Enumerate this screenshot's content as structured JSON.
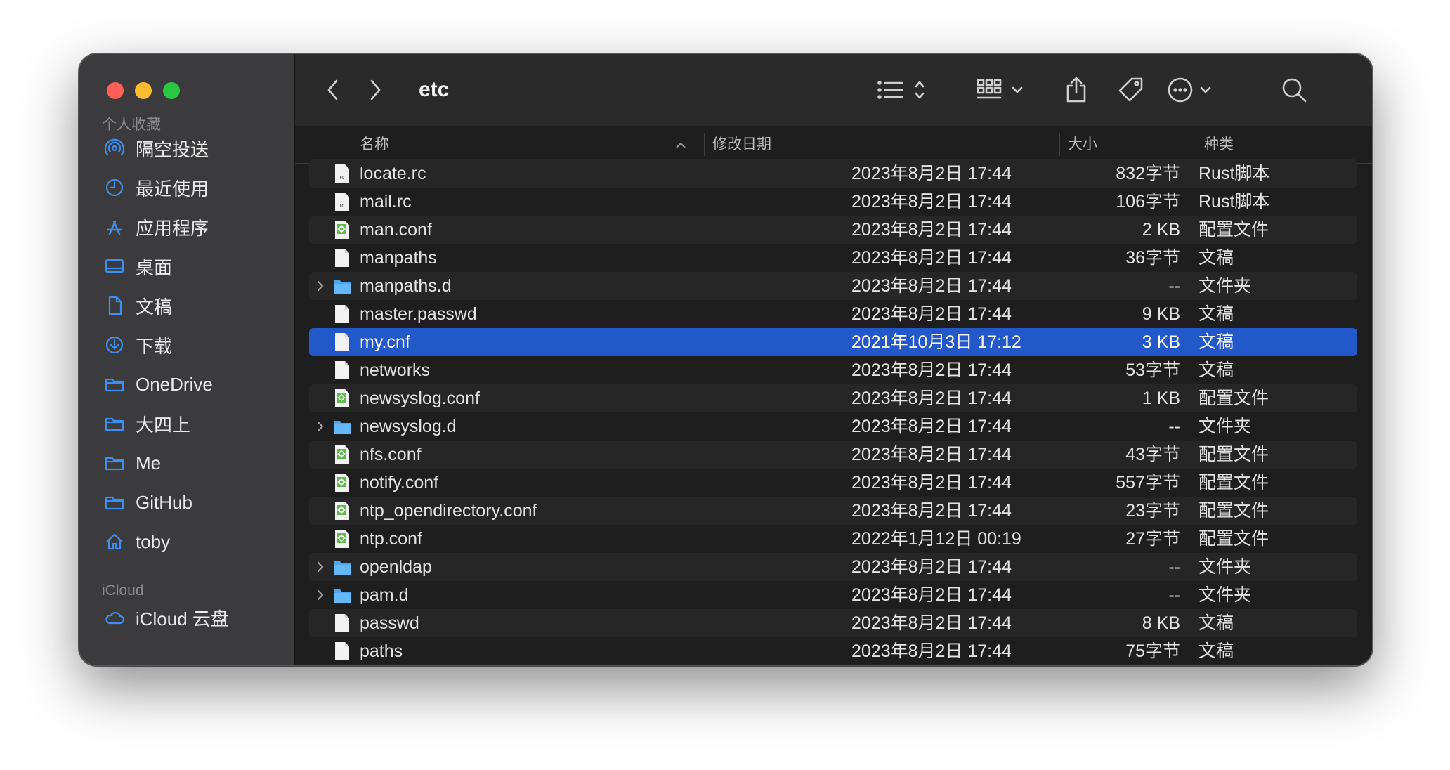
{
  "toolbar": {
    "title": "etc",
    "back_icon": "chevron-left-icon",
    "forward_icon": "chevron-right-icon",
    "view_icon": "list-view-icon",
    "group_icon": "grid-group-icon",
    "share_icon": "share-icon",
    "tag_icon": "tag-icon",
    "more_icon": "ellipsis-circle-icon",
    "search_icon": "search-icon"
  },
  "sidebar": {
    "favorites_title": "个人收藏",
    "items": [
      {
        "label": "隔空投送",
        "icon": "airdrop-icon"
      },
      {
        "label": "最近使用",
        "icon": "clock-icon"
      },
      {
        "label": "应用程序",
        "icon": "applications-icon"
      },
      {
        "label": "桌面",
        "icon": "desktop-icon"
      },
      {
        "label": "文稿",
        "icon": "document-icon"
      },
      {
        "label": "下载",
        "icon": "download-icon"
      },
      {
        "label": "OneDrive",
        "icon": "folder-icon"
      },
      {
        "label": "大四上",
        "icon": "folder-icon"
      },
      {
        "label": "Me",
        "icon": "folder-icon"
      },
      {
        "label": "GitHub",
        "icon": "folder-icon"
      },
      {
        "label": "toby",
        "icon": "home-icon"
      }
    ],
    "icloud_title": "iCloud",
    "icloud_items": [
      {
        "label": "iCloud 云盘",
        "icon": "cloud-icon"
      }
    ]
  },
  "columns": {
    "name": "名称",
    "date": "修改日期",
    "size": "大小",
    "kind": "种类"
  },
  "colors": {
    "selection": "#2358c9",
    "folder": "#4aa8f0",
    "config_icon": "#5fb84a"
  },
  "files": [
    {
      "name": "locate.rc",
      "date": "2023年8月2日 17:44",
      "size": "832字节",
      "kind": "Rust脚本",
      "type": "rc"
    },
    {
      "name": "mail.rc",
      "date": "2023年8月2日 17:44",
      "size": "106字节",
      "kind": "Rust脚本",
      "type": "rc"
    },
    {
      "name": "man.conf",
      "date": "2023年8月2日 17:44",
      "size": "2 KB",
      "kind": "配置文件",
      "type": "conf"
    },
    {
      "name": "manpaths",
      "date": "2023年8月2日 17:44",
      "size": "36字节",
      "kind": "文稿",
      "type": "doc"
    },
    {
      "name": "manpaths.d",
      "date": "2023年8月2日 17:44",
      "size": "--",
      "kind": "文件夹",
      "type": "folder"
    },
    {
      "name": "master.passwd",
      "date": "2023年8月2日 17:44",
      "size": "9 KB",
      "kind": "文稿",
      "type": "doc"
    },
    {
      "name": "my.cnf",
      "date": "2021年10月3日 17:12",
      "size": "3 KB",
      "kind": "文稿",
      "type": "doc",
      "selected": true
    },
    {
      "name": "networks",
      "date": "2023年8月2日 17:44",
      "size": "53字节",
      "kind": "文稿",
      "type": "doc"
    },
    {
      "name": "newsyslog.conf",
      "date": "2023年8月2日 17:44",
      "size": "1 KB",
      "kind": "配置文件",
      "type": "conf"
    },
    {
      "name": "newsyslog.d",
      "date": "2023年8月2日 17:44",
      "size": "--",
      "kind": "文件夹",
      "type": "folder"
    },
    {
      "name": "nfs.conf",
      "date": "2023年8月2日 17:44",
      "size": "43字节",
      "kind": "配置文件",
      "type": "conf"
    },
    {
      "name": "notify.conf",
      "date": "2023年8月2日 17:44",
      "size": "557字节",
      "kind": "配置文件",
      "type": "conf"
    },
    {
      "name": "ntp_opendirectory.conf",
      "date": "2023年8月2日 17:44",
      "size": "23字节",
      "kind": "配置文件",
      "type": "conf"
    },
    {
      "name": "ntp.conf",
      "date": "2022年1月12日 00:19",
      "size": "27字节",
      "kind": "配置文件",
      "type": "conf"
    },
    {
      "name": "openldap",
      "date": "2023年8月2日 17:44",
      "size": "--",
      "kind": "文件夹",
      "type": "folder"
    },
    {
      "name": "pam.d",
      "date": "2023年8月2日 17:44",
      "size": "--",
      "kind": "文件夹",
      "type": "folder"
    },
    {
      "name": "passwd",
      "date": "2023年8月2日 17:44",
      "size": "8 KB",
      "kind": "文稿",
      "type": "doc"
    },
    {
      "name": "paths",
      "date": "2023年8月2日 17:44",
      "size": "75字节",
      "kind": "文稿",
      "type": "doc"
    }
  ]
}
